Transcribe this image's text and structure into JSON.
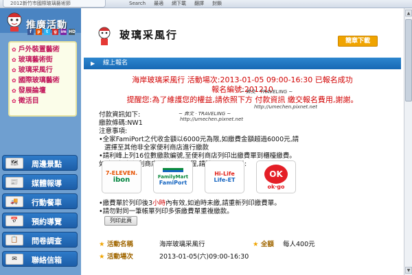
{
  "browser": {
    "tab_title": "2012新竹市國際玻璃藝術節",
    "toolbar": [
      "Search",
      "最適",
      "網下載",
      "翻譯",
      "封鎖"
    ]
  },
  "sidebar": {
    "promo_title": "推廣活動",
    "social_icons": [
      "f",
      "p",
      "t",
      "g",
      "im",
      "HD"
    ],
    "links": [
      "戶外裝置藝術",
      "玻璃藝術街",
      "玻璃采風行",
      "國際玻璃藝術",
      "發展論壇",
      "徵活目"
    ],
    "menu": [
      {
        "label": "周邊景點",
        "icon": "map-icon"
      },
      {
        "label": "媒體報導",
        "icon": "newspaper-icon"
      },
      {
        "label": "行動餐車",
        "icon": "truck-icon"
      },
      {
        "label": "預約導覽",
        "icon": "calendar-icon"
      },
      {
        "label": "問卷調查",
        "icon": "survey-icon"
      },
      {
        "label": "聯絡信箱",
        "icon": "mail-icon"
      }
    ]
  },
  "main": {
    "title": "玻璃采風行",
    "download_button": "簡章下載",
    "section_label": "線上報名",
    "result": {
      "line1": "海岸玻璃采風行 活動場次:2013-01-05 09:00-16:30 已報名成功",
      "line2": "報名編號:201210",
      "line3": "提醒您:為了維護您的權益,請依照下方 付款資訊 繳交報名費用,謝謝。"
    },
    "watermark": "~ 奔文 · TRAVELING ~",
    "watermark_url": "http://umechen.pixnet.net",
    "payment": {
      "heading": "付款資訊如下:",
      "code_label": "繳款條碼:NW1",
      "notes_heading": "注意事項:",
      "note1a": "•全家FamiPort之代收金額以6000元為限,如繳費金額超過6000元,請",
      "note1b": "選擇至其他非全家便利商店進行繳款",
      "note2a": "•請利峰上列16位數繳款編號,至便利商店列印出繳費單到櫃檯繳費。",
      "note2b": "如欲了解各便利商店繳費操作流程,請點選以下圖示:"
    },
    "stores": [
      {
        "name": "7-ELEVEN.",
        "sub": "ibon",
        "color": "#00843d"
      },
      {
        "name": "FamilyMart",
        "sub": "FamiPort",
        "color": "#0a8a3c"
      },
      {
        "name": "Hi-Life",
        "sub": "Life-ET",
        "color": "#e2231a"
      },
      {
        "name": "OK",
        "sub": "ok·go",
        "color": "#e41e26"
      }
    ],
    "notes_after": {
      "line1_pre": "•繳費單於列印後3",
      "line1_red": "小時",
      "line1_post": "內有效,如逾時未繳,請重新列印繳費單。",
      "line2": "•請勿對同一筆帳單列印多張繳費單重複繳款。"
    },
    "print_button": "列印此頁",
    "details": [
      {
        "key": "活動名稱",
        "value": "海岸玻璃采風行",
        "key2": "全額",
        "value2": "每人400元"
      },
      {
        "key": "活動場次",
        "value": "2013-01-05(六)09:00-16:30"
      }
    ]
  },
  "colors": {
    "accent_blue": "#1d6fb8",
    "sidebar_blue": "#6f9fd0",
    "alert_red": "#d10000",
    "button_orange": "#f0a400"
  }
}
